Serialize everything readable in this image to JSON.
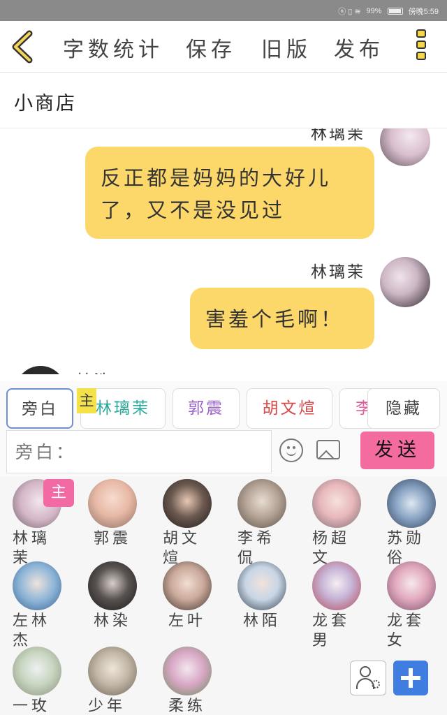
{
  "status": {
    "icons": "ⓝ ▯ ≋",
    "battery": "99%",
    "time": "傍晚5:59"
  },
  "toolbar": {
    "word_count": "字数统计",
    "save": "保存",
    "old_version": "旧版",
    "publish": "发布"
  },
  "story_title": "小商店",
  "messages": [
    {
      "speaker": "林璃茉",
      "text": "反正都是妈妈的大好儿了，又不是没见过"
    },
    {
      "speaker": "林璃茉",
      "text": "害羞个毛啊！"
    }
  ],
  "partial_speaker": "林浩",
  "composer": {
    "main_marker": "主",
    "role_tabs": [
      {
        "label": "旁白",
        "color": "#444444"
      },
      {
        "label": "林璃茉",
        "color": "#2aa89a"
      },
      {
        "label": "郭震",
        "color": "#9b63c9"
      },
      {
        "label": "胡文煊",
        "color": "#d94848"
      },
      {
        "label": "李",
        "color": "#e05c9c"
      }
    ],
    "hide": "隐藏",
    "input_placeholder": "旁白：",
    "send": "发送"
  },
  "characters": [
    {
      "name": "林璃茉",
      "main": true
    },
    {
      "name": "郭震"
    },
    {
      "name": "胡文煊"
    },
    {
      "name": "李希侃"
    },
    {
      "name": "杨超文"
    },
    {
      "name": "苏勋俗"
    },
    {
      "name": "左林杰"
    },
    {
      "name": "林染"
    },
    {
      "name": "左叶"
    },
    {
      "name": "林陌"
    },
    {
      "name": "龙套男"
    },
    {
      "name": "龙套女"
    },
    {
      "name": "一玫"
    },
    {
      "name": "少年"
    },
    {
      "name": "柔练"
    }
  ],
  "roster_main_badge": "主"
}
